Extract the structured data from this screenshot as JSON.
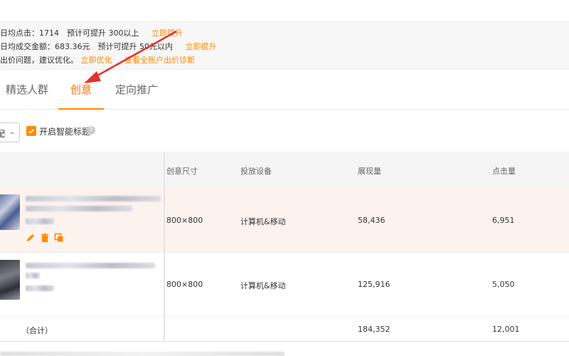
{
  "notice": {
    "line1": {
      "text": "日均点击：1714　预计可提升 300以上",
      "link": "立即提升"
    },
    "line2": {
      "text": "日均成交金额：683.36元　预计可提升 50元以内",
      "link": "立即提升"
    },
    "line3": {
      "text": "出价问题，建议优化。",
      "link1": "立即优化",
      "link2": "查看全账户出价诊断"
    }
  },
  "tabs": [
    {
      "label": "精选人群"
    },
    {
      "label": "创意",
      "active": true
    },
    {
      "label": "定向推广"
    }
  ],
  "toolbar": {
    "dropdown_value": "配",
    "smart_title_label": "开启智能标题",
    "smart_title_checked": true
  },
  "table": {
    "headers": [
      "创意尺寸",
      "投放设备",
      "展现量",
      "点击量"
    ],
    "rows": [
      {
        "size": "800×800",
        "device": "计算机&移动",
        "impressions": "58,436",
        "clicks": "6,951"
      },
      {
        "size": "800×800",
        "device": "计算机&移动",
        "impressions": "125,916",
        "clicks": "5,050"
      }
    ],
    "total": {
      "label": "（合计）",
      "impressions": "184,352",
      "clicks": "12,001"
    }
  },
  "colors": {
    "accent": "#ff8a00",
    "active_tab": "#ff6d00",
    "arrow": "#e0342b",
    "row_highlight": "#fdf3ee"
  },
  "icons": [
    "edit-icon",
    "delete-icon",
    "copy-icon",
    "help-icon",
    "chevron-down-icon",
    "check-icon"
  ]
}
